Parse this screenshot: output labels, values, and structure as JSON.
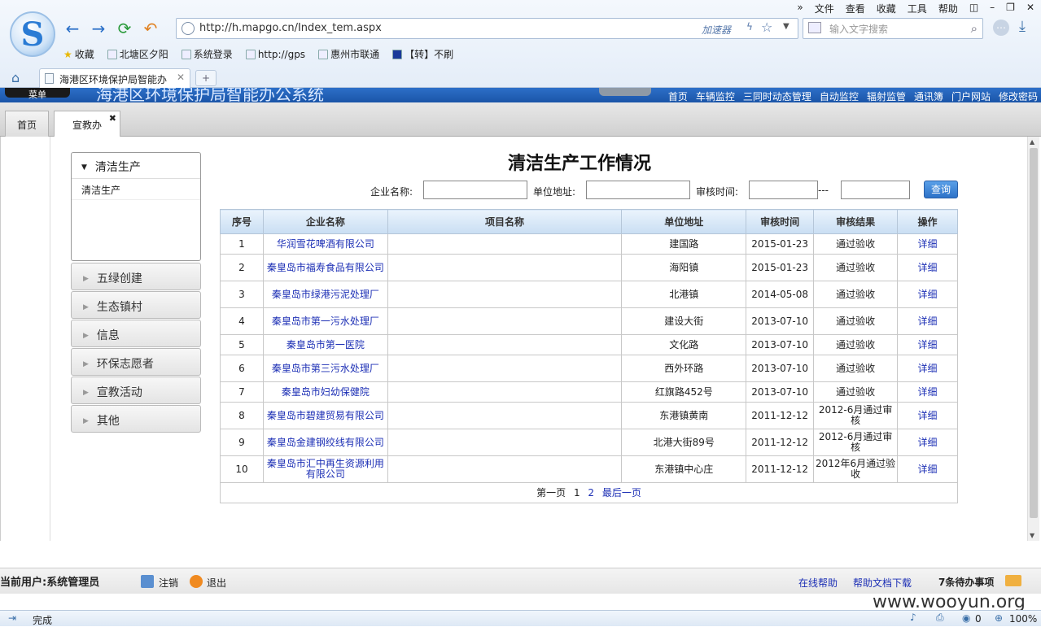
{
  "browser": {
    "menu": [
      "文件",
      "查看",
      "收藏",
      "工具",
      "帮助"
    ],
    "url": "http://h.mapgo.cn/Index_tem.aspx",
    "accelerator": "加速器",
    "search_placeholder": "输入文字搜索",
    "bookmarks": [
      "收藏",
      "北塘区夕阳",
      "系统登录",
      "http://gps",
      "惠州市联通",
      "【转】不刷"
    ],
    "tab_title": "海港区环境保护局智能办",
    "status_text": "完成",
    "zoom": "100%",
    "status_count": "0"
  },
  "app": {
    "banner_title": "海港区环境保护局智能办公系统",
    "home_label": "菜单",
    "top_nav": [
      "首页",
      "车辆监控",
      "三同时动态管理",
      "自动监控",
      "辐射监管",
      "通讯簿",
      "门户网站",
      "修改密码"
    ],
    "tabs": [
      {
        "label": "首页"
      },
      {
        "label": "宣教办"
      }
    ],
    "tab_close": "✖"
  },
  "sidebar": {
    "open_section": {
      "label": "清洁生产",
      "items": [
        "清洁生产"
      ]
    },
    "sections": [
      "五绿创建",
      "生态镇村",
      "信息",
      "环保志愿者",
      "宣教活动",
      "其他"
    ]
  },
  "main": {
    "title": "清洁生产工作情况",
    "filters": {
      "company_label": "企业名称:",
      "address_label": "单位地址:",
      "time_label": "审核时间:",
      "range_sep": "---",
      "query_button": "查询"
    },
    "columns": [
      "序号",
      "企业名称",
      "项目名称",
      "单位地址",
      "审核时间",
      "审核结果",
      "操作"
    ],
    "rows": [
      {
        "no": "1",
        "company": "华润雪花啤酒有限公司",
        "project": "",
        "address": "建国路",
        "date": "2015-01-23",
        "result": "通过验收",
        "action": "详细"
      },
      {
        "no": "2",
        "company": "秦皇岛市福寿食品有限公司",
        "project": "",
        "address": "海阳镇",
        "date": "2015-01-23",
        "result": "通过验收",
        "action": "详细"
      },
      {
        "no": "3",
        "company": "秦皇岛市绿港污泥处理厂",
        "project": "",
        "address": "北港镇",
        "date": "2014-05-08",
        "result": "通过验收",
        "action": "详细"
      },
      {
        "no": "4",
        "company": "秦皇岛市第一污水处理厂",
        "project": "",
        "address": "建设大街",
        "date": "2013-07-10",
        "result": "通过验收",
        "action": "详细"
      },
      {
        "no": "5",
        "company": "秦皇岛市第一医院",
        "project": "",
        "address": "文化路",
        "date": "2013-07-10",
        "result": "通过验收",
        "action": "详细"
      },
      {
        "no": "6",
        "company": "秦皇岛市第三污水处理厂",
        "project": "",
        "address": "西外环路",
        "date": "2013-07-10",
        "result": "通过验收",
        "action": "详细"
      },
      {
        "no": "7",
        "company": "秦皇岛市妇幼保健院",
        "project": "",
        "address": "红旗路452号",
        "date": "2013-07-10",
        "result": "通过验收",
        "action": "详细"
      },
      {
        "no": "8",
        "company": "秦皇岛市碧建贸易有限公司",
        "project": "",
        "address": "东港镇黄南",
        "date": "2011-12-12",
        "result": "2012-6月通过审核",
        "action": "详细"
      },
      {
        "no": "9",
        "company": "秦皇岛金建钢绞线有限公司",
        "project": "",
        "address": "北港大街89号",
        "date": "2011-12-12",
        "result": "2012-6月通过审核",
        "action": "详细"
      },
      {
        "no": "10",
        "company": "秦皇岛市汇中再生资源利用有限公司",
        "project": "",
        "address": "东港镇中心庄",
        "date": "2011-12-12",
        "result": "2012年6月通过验收",
        "action": "详细"
      }
    ],
    "pager": {
      "first": "第一页",
      "pages": [
        "1",
        "2"
      ],
      "last": "最后一页"
    }
  },
  "footer": {
    "user_label": "当前用户:系统管理员",
    "logout": "注销",
    "exit": "退出",
    "help": "在线帮助",
    "doc_download": "帮助文档下载",
    "todo": "7条待办事项"
  },
  "watermark": "www.wooyun.org"
}
